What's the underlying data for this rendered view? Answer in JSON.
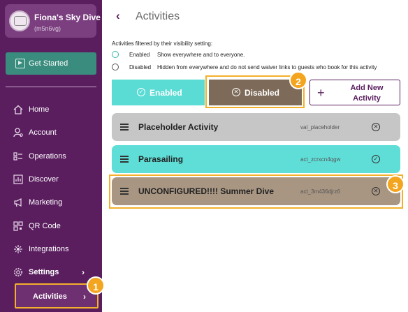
{
  "org": {
    "name": "Fiona's Sky Dive",
    "id": "(m5n6vg)"
  },
  "sidebar": {
    "get_started": "Get Started",
    "items": [
      {
        "label": "Home",
        "icon": "home-icon"
      },
      {
        "label": "Account",
        "icon": "account-icon"
      },
      {
        "label": "Operations",
        "icon": "operations-icon"
      },
      {
        "label": "Discover",
        "icon": "discover-icon"
      },
      {
        "label": "Marketing",
        "icon": "megaphone-icon"
      },
      {
        "label": "QR Code",
        "icon": "qr-code-icon"
      },
      {
        "label": "Integrations",
        "icon": "integrations-icon"
      },
      {
        "label": "Settings",
        "icon": "gear-icon"
      }
    ],
    "activities": "Activities",
    "chevron": "›"
  },
  "header": {
    "back": "‹",
    "title": "Activities"
  },
  "filter": {
    "intro": "Activities filtered by their visibility setting:",
    "enabled_name": "Enabled",
    "enabled_desc": "Show everywhere and to everyone.",
    "disabled_name": "Disabled",
    "disabled_desc": "Hidden from everywhere and do not send waiver links to guests who book for this activity"
  },
  "tabs": {
    "enabled": "Enabled",
    "disabled": "Disabled",
    "check": "✓",
    "x": "✕"
  },
  "add_button": {
    "plus": "+",
    "label": "Add New Activity"
  },
  "activities": [
    {
      "name": "Placeholder Activity",
      "code": "val_placeholder",
      "status": "disabled",
      "color": "#c6c6c6"
    },
    {
      "name": "Parasailing",
      "code": "act_zcrxcn4qgw",
      "status": "enabled",
      "color": "#5fded8"
    },
    {
      "name": "UNCONFIGURED!!!! Summer Dive",
      "code": "act_3m436djrz6",
      "status": "disabled",
      "color": "#a89683"
    }
  ],
  "status_icons": {
    "enabled": "✓",
    "disabled": "✕"
  },
  "badges": {
    "one": "1",
    "two": "2",
    "three": "3"
  },
  "colors": {
    "sidebar": "#5a1e5f",
    "accent_teal": "#5adbd4",
    "accent_brown": "#7d6a58",
    "highlight": "#f4b02a"
  }
}
